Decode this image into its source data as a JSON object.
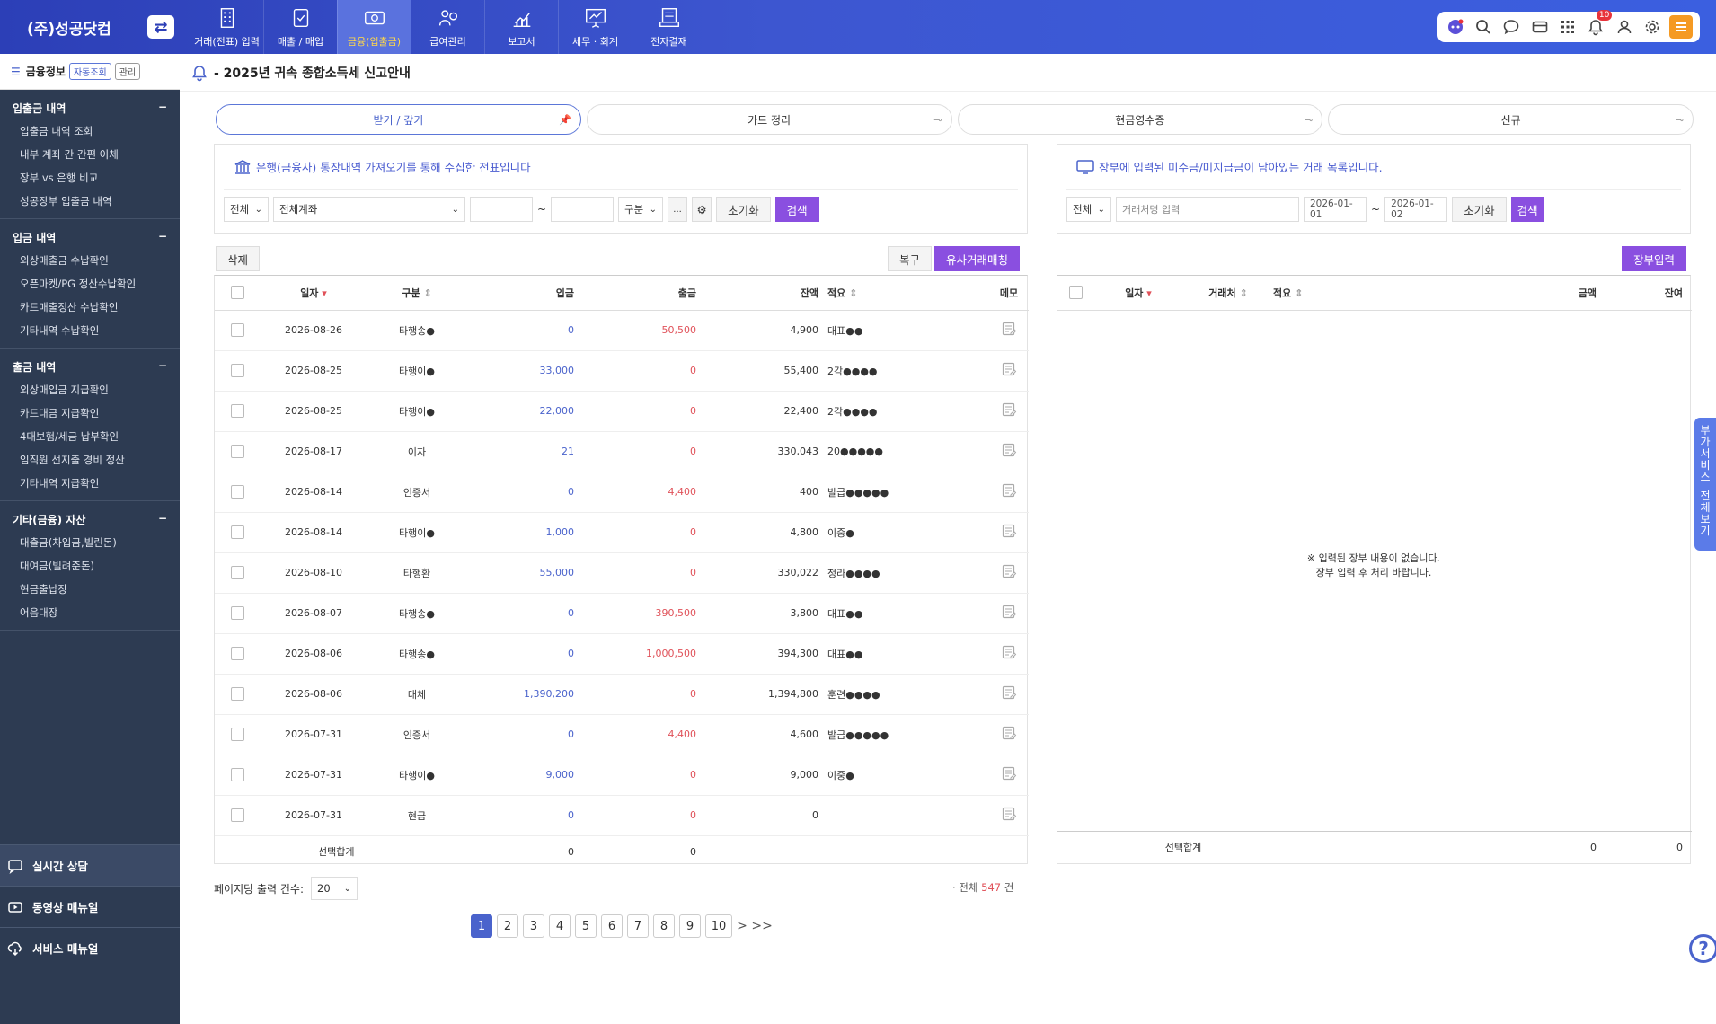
{
  "company": "(주)성공닷컴",
  "nav": [
    {
      "label": "거래(전표) 입력",
      "icon": "building-icon"
    },
    {
      "label": "매출 / 매입",
      "icon": "document-check-icon"
    },
    {
      "label": "금융(입출금)",
      "icon": "money-card-icon"
    },
    {
      "label": "급여관리",
      "icon": "people-coin-icon"
    },
    {
      "label": "보고서",
      "icon": "chart-icon"
    },
    {
      "label": "세무 · 회계",
      "icon": "presentation-chart-icon"
    },
    {
      "label": "전자결재",
      "icon": "approval-icon"
    }
  ],
  "notification_count": "10",
  "sidebar": {
    "title": "금융정보",
    "chip_auto": "자동조회",
    "chip_manage": "관리",
    "groups": [
      {
        "title": "입출금 내역",
        "items": [
          "입출금 내역 조회",
          "내부 계좌 간 간편 이체",
          "장부 vs 은행 비교",
          "성공장부 입출금 내역"
        ]
      },
      {
        "title": "입금 내역",
        "items": [
          "외상매출금 수납확인",
          "오픈마켓/PG 정산수납확인",
          "카드매출정산 수납확인",
          "기타내역 수납확인"
        ]
      },
      {
        "title": "출금 내역",
        "items": [
          "외상매입금 지급확인",
          "카드대금 지급확인",
          "4대보험/세금 납부확인",
          "임직원 선지출 경비 정산",
          "기타내역 지급확인"
        ]
      },
      {
        "title": "기타(금융) 자산",
        "items": [
          "대출금(차입금,빌린돈)",
          "대여금(빌려준돈)",
          "현금출납장",
          "어음대장"
        ]
      }
    ],
    "bottom": [
      "실시간 상담",
      "동영상 매뉴얼",
      "서비스 매뉴얼"
    ]
  },
  "notice": "- 2025년 귀속 종합소득세 신고안내",
  "tabs": [
    "받기 / 갚기",
    "카드 정리",
    "현금영수증",
    "신규"
  ],
  "left": {
    "message": "은행(금융사) 통장내역 가져오기를 통해 수집한 전표입니다",
    "filter_all": "전체",
    "filter_account": "전체계좌",
    "tilde": "~",
    "filter_type": "구분",
    "dots": "...",
    "reset": "초기화",
    "search": "검색",
    "delete": "삭제",
    "restore": "복구",
    "match": "유사거래매칭",
    "columns": [
      "일자",
      "구분",
      "입금",
      "출금",
      "잔액",
      "적요",
      "메모"
    ],
    "rows": [
      {
        "date": "2026-08-26",
        "type": "타행송●",
        "in": "0",
        "out": "50,500",
        "bal": "4,900",
        "memo": "대표●●"
      },
      {
        "date": "2026-08-25",
        "type": "타행이●",
        "in": "33,000",
        "out": "0",
        "bal": "55,400",
        "memo": "2각●●●●"
      },
      {
        "date": "2026-08-25",
        "type": "타행이●",
        "in": "22,000",
        "out": "0",
        "bal": "22,400",
        "memo": "2각●●●●"
      },
      {
        "date": "2026-08-17",
        "type": "이자",
        "in": "21",
        "out": "0",
        "bal": "330,043",
        "memo": "20●●●●●"
      },
      {
        "date": "2026-08-14",
        "type": "인증서",
        "in": "0",
        "out": "4,400",
        "bal": "400",
        "memo": "발급●●●●●"
      },
      {
        "date": "2026-08-14",
        "type": "타행이●",
        "in": "1,000",
        "out": "0",
        "bal": "4,800",
        "memo": "이중●"
      },
      {
        "date": "2026-08-10",
        "type": "타행환",
        "in": "55,000",
        "out": "0",
        "bal": "330,022",
        "memo": "청라●●●●"
      },
      {
        "date": "2026-08-07",
        "type": "타행송●",
        "in": "0",
        "out": "390,500",
        "bal": "3,800",
        "memo": "대표●●"
      },
      {
        "date": "2026-08-06",
        "type": "타행송●",
        "in": "0",
        "out": "1,000,500",
        "bal": "394,300",
        "memo": "대표●●"
      },
      {
        "date": "2026-08-06",
        "type": "대체",
        "in": "1,390,200",
        "out": "0",
        "bal": "1,394,800",
        "memo": "훈련●●●●"
      },
      {
        "date": "2026-07-31",
        "type": "인증서",
        "in": "0",
        "out": "4,400",
        "bal": "4,600",
        "memo": "발급●●●●●"
      },
      {
        "date": "2026-07-31",
        "type": "타행이●",
        "in": "9,000",
        "out": "0",
        "bal": "9,000",
        "memo": "이중●"
      },
      {
        "date": "2026-07-31",
        "type": "현금",
        "in": "0",
        "out": "0",
        "bal": "0",
        "memo": ""
      }
    ],
    "footer_label": "선택합계",
    "footer_in": "0",
    "footer_out": "0",
    "page_size_label": "페이지당 출력 건수:",
    "page_size": "20",
    "total_prefix": "· 전체",
    "total_count": "547",
    "total_suffix": "건"
  },
  "right": {
    "message": "장부에 입력된 미수금/미지급금이 남아있는 거래 목록입니다.",
    "filter_all": "전체",
    "client_placeholder": "거래처명 입력",
    "date_from": "2026-01-01",
    "tilde": "~",
    "date_to": "2026-01-02",
    "reset": "초기화",
    "search": "검색",
    "ledger_btn": "장부입력",
    "columns": [
      "일자",
      "거래처",
      "적요",
      "금액",
      "잔여"
    ],
    "empty_line1": "※ 입력된 장부 내용이 없습니다.",
    "empty_line2": "장부 입력 후 처리 바랍니다.",
    "footer_label": "선택합계",
    "footer_amount": "0",
    "footer_remain": "0"
  },
  "pages": [
    "1",
    "2",
    "3",
    "4",
    "5",
    "6",
    "7",
    "8",
    "9",
    "10"
  ],
  "next_label": "> >>",
  "side_tab": [
    "부",
    "가",
    "서",
    "비",
    "스",
    "",
    "전",
    "체",
    "보",
    "기"
  ],
  "help": "?"
}
